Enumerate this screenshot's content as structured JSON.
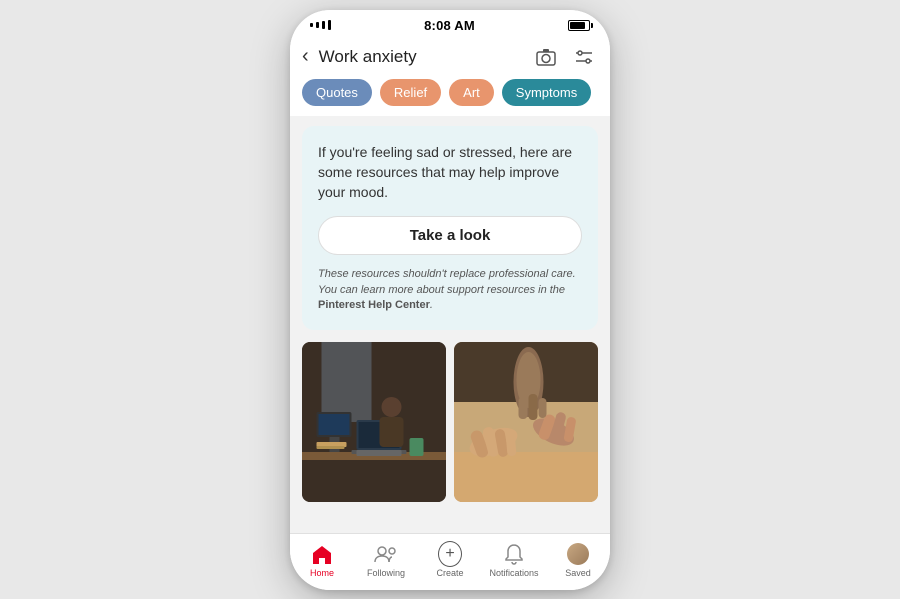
{
  "status_bar": {
    "signal": "signal",
    "time": "8:08 AM",
    "battery": "full"
  },
  "search": {
    "title": "Work anxiety",
    "back_label": "‹",
    "camera_label": "camera",
    "filter_label": "filter"
  },
  "tabs": [
    {
      "id": "quotes",
      "label": "Quotes",
      "active": false,
      "style": "quotes"
    },
    {
      "id": "relief",
      "label": "Relief",
      "active": false,
      "style": "relief"
    },
    {
      "id": "art",
      "label": "Art",
      "active": false,
      "style": "art"
    },
    {
      "id": "symptoms",
      "label": "Symptoms",
      "active": true,
      "style": "symptoms"
    }
  ],
  "resource_card": {
    "body_text": "If you're feeling sad or stressed, here are some resources that may help improve your mood.",
    "cta_label": "Take a look",
    "disclaimer": "These resources shouldn't replace professional care. You can learn more about support resources in the ",
    "disclaimer_link": "Pinterest Help Center",
    "disclaimer_end": "."
  },
  "images": [
    {
      "id": "work-desk",
      "alt": "Person working at desk with laptop"
    },
    {
      "id": "hands",
      "alt": "People gesturing with hands in meeting"
    }
  ],
  "bottom_nav": [
    {
      "id": "home",
      "label": "Home",
      "active": true,
      "icon": "home-icon"
    },
    {
      "id": "following",
      "label": "Following",
      "active": false,
      "icon": "following-icon"
    },
    {
      "id": "create",
      "label": "Create",
      "active": false,
      "icon": "create-icon"
    },
    {
      "id": "notifications",
      "label": "Notifications",
      "active": false,
      "icon": "bell-icon"
    },
    {
      "id": "saved",
      "label": "Saved",
      "active": false,
      "icon": "avatar-icon"
    }
  ],
  "colors": {
    "pinterest_red": "#e60023",
    "quotes_bg": "#6b8cba",
    "relief_bg": "#e8956d",
    "art_bg": "#e8956d",
    "symptoms_bg": "#2a8a9a",
    "card_bg": "#e8f4f6"
  }
}
